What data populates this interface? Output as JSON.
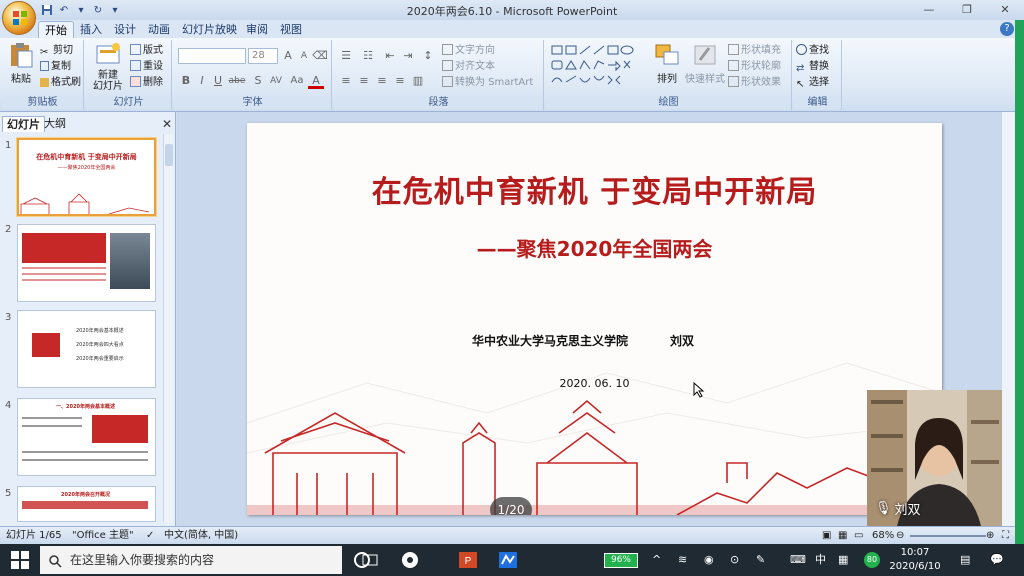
{
  "window": {
    "title": "2020年两会6.10 - Microsoft PowerPoint"
  },
  "ribbon_tabs": [
    "开始",
    "插入",
    "设计",
    "动画",
    "幻灯片放映",
    "审阅",
    "视图"
  ],
  "ribbon": {
    "clipboard": {
      "label": "剪贴板",
      "paste": "粘贴",
      "cut": "剪切",
      "copy": "复制",
      "format_painter": "格式刷"
    },
    "slides": {
      "label": "幻灯片",
      "new_slide": "新建\n幻灯片",
      "layout": "版式",
      "reset": "重设",
      "delete": "删除"
    },
    "font": {
      "label": "字体",
      "size": "28",
      "buttons": [
        "B",
        "I",
        "U",
        "abe",
        "S",
        "AV",
        "Aa",
        "A"
      ]
    },
    "paragraph": {
      "label": "段落",
      "text_direction": "文字方向",
      "align_text": "对齐文本",
      "convert_smartart": "转换为 SmartArt"
    },
    "drawing": {
      "label": "绘图",
      "arrange": "排列",
      "quick_styles": "快速样式",
      "shape_fill": "形状填充",
      "shape_outline": "形状轮廓",
      "shape_effects": "形状效果"
    },
    "editing": {
      "label": "编辑",
      "find": "查找",
      "replace": "替换",
      "select": "选择"
    }
  },
  "left_panel": {
    "tabs": [
      "幻灯片",
      "大纲"
    ],
    "close": "✕",
    "thumbnails": [
      {
        "num": "1",
        "title": "在危机中育新机 于变局中开新局",
        "subtitle": "——聚焦2020年全国两会"
      },
      {
        "num": "2",
        "title": ""
      },
      {
        "num": "3",
        "items": [
          "2020年两会基本概述",
          "2020年两会四大看点",
          "2020年两会重要启示"
        ]
      },
      {
        "num": "4",
        "title": "一、2020年两会基本概述"
      },
      {
        "num": "5",
        "title": "2020年两会召开概况"
      }
    ]
  },
  "slide": {
    "title": "在危机中育新机  于变局中开新局",
    "subtitle": "——聚焦2020年全国两会",
    "author": "华中农业大学马克思主义学院",
    "name": "刘双",
    "date": "2020. 06. 10",
    "counter": "1/20"
  },
  "webcam": {
    "name": "刘双"
  },
  "statusbar": {
    "slide_info": "幻灯片 1/65",
    "theme": "\"Office 主题\"",
    "language": "中文(简体, 中国)",
    "zoom": "68%"
  },
  "taskbar": {
    "search_placeholder": "在这里输入你要搜索的内容",
    "battery": "96%",
    "ime": "中",
    "badge": "80",
    "time": "10:07",
    "date": "2020/6/10"
  },
  "colors": {
    "accent_red": "#b71c1c",
    "ribbon_blue": "#dde8f5",
    "taskbar": "#1f2a33"
  }
}
